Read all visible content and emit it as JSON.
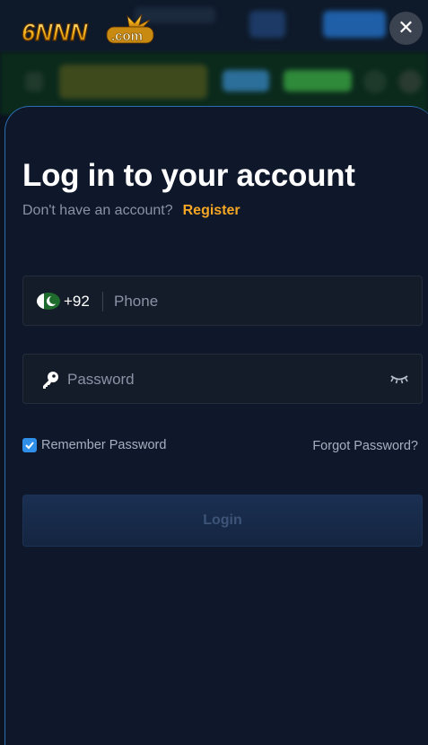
{
  "brand": {
    "logo_text": "6NNN",
    "logo_suffix": ".com"
  },
  "header": {
    "close_icon": "close-icon"
  },
  "login": {
    "title": "Log in to your account",
    "no_account_text": "Don't have an account?",
    "register_link": "Register",
    "phone": {
      "country_code": "+92",
      "placeholder": "Phone",
      "flag": "pakistan-flag"
    },
    "password": {
      "placeholder": "Password",
      "icon": "key-icon",
      "toggle_icon": "eye-closed-icon"
    },
    "remember_label": "Remember Password",
    "remember_checked": true,
    "forgot_link": "Forgot Password?",
    "login_button": "Login"
  },
  "colors": {
    "accent": "#f5a623",
    "panel": "#0f172b",
    "checkbox": "#2f8fe8",
    "button": "#1a2f52"
  }
}
